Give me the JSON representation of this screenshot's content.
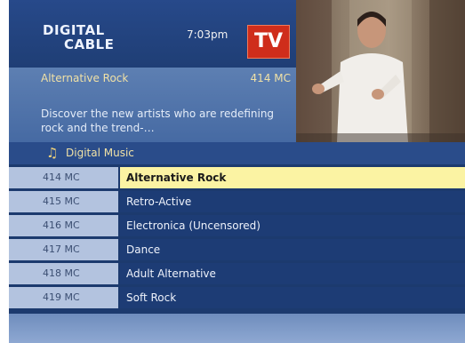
{
  "header": {
    "logo_line1": "DIGITAL",
    "logo_line2": "CABLE",
    "time": "7:03pm",
    "tv_badge": "TV"
  },
  "info": {
    "title": "Alternative Rock",
    "channel": "414 MC",
    "description": "Discover the new artists who are redefining rock and the trend-…"
  },
  "section": {
    "icon": "music-note-icon",
    "label": "Digital Music"
  },
  "channels": [
    {
      "number": "414 MC",
      "name": "Alternative Rock",
      "selected": true
    },
    {
      "number": "415 MC",
      "name": "Retro-Active"
    },
    {
      "number": "416 MC",
      "name": "Electronica (Uncensored)"
    },
    {
      "number": "417 MC",
      "name": "Dance"
    },
    {
      "number": "418 MC",
      "name": "Adult Alternative"
    },
    {
      "number": "419 MC",
      "name": "Soft Rock"
    }
  ],
  "colors": {
    "selected_row": "#fbf3a3",
    "row_bg": "#1d3c75",
    "number_bg": "#b3c3df",
    "tv_badge": "#cf2d1b"
  }
}
